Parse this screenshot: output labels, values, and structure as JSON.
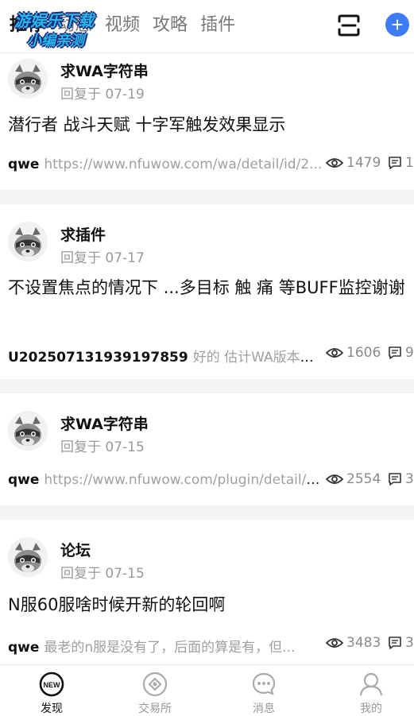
{
  "header": {
    "tabs": [
      {
        "label": "推荐",
        "active": true
      },
      {
        "label": "动态",
        "active": false
      },
      {
        "label": "视频",
        "active": false
      },
      {
        "label": "攻略",
        "active": false
      },
      {
        "label": "插件",
        "active": false
      }
    ],
    "watermark_line1": "游娱乐下载",
    "watermark_line2": "小编亲测",
    "scan_icon": "scan-icon",
    "add_icon": "plus-icon",
    "add_label": "+"
  },
  "posts": [
    {
      "username": "求WA字符串",
      "reply_time": "回复于 07-19",
      "title": "潜行者  战斗天赋 十字军触发效果显示",
      "author": "qwe",
      "preview": "https://www.nfuwow.com/wa/detail/id/2...",
      "views": "1479",
      "comments": "1"
    },
    {
      "username": "求插件",
      "reply_time": "回复于 07-17",
      "title": "不设置焦点的情况下 ...多目标 触  痛 等BUFF监控谢谢",
      "author": "U202507131939197859",
      "preview": "好的  估计WA版本不...",
      "views": "1606",
      "comments": "9"
    },
    {
      "username": "求WA字符串",
      "reply_time": "回复于 07-15",
      "title": "",
      "author": "qwe",
      "preview": "https://www.nfuwow.com/plugin/detail/a...",
      "views": "2554",
      "comments": "3"
    },
    {
      "username": "论坛",
      "reply_time": "回复于 07-15",
      "title": "N服60服啥时候开新的轮回啊",
      "author": "qwe",
      "preview": "最老的n服是没有了，后面的算是有，但...",
      "views": "3483",
      "comments": "3"
    }
  ],
  "bottom_nav": [
    {
      "label": "发现",
      "icon": "new-icon",
      "active": true
    },
    {
      "label": "交易所",
      "icon": "exchange-icon",
      "active": false
    },
    {
      "label": "消息",
      "icon": "message-icon",
      "active": false
    },
    {
      "label": "我的",
      "icon": "profile-icon",
      "active": false
    }
  ],
  "colors": {
    "accent": "#3d7cf2",
    "separator": "#f3f4f5",
    "muted_text": "#9a9a9a",
    "watermark": "#29b6ea"
  }
}
